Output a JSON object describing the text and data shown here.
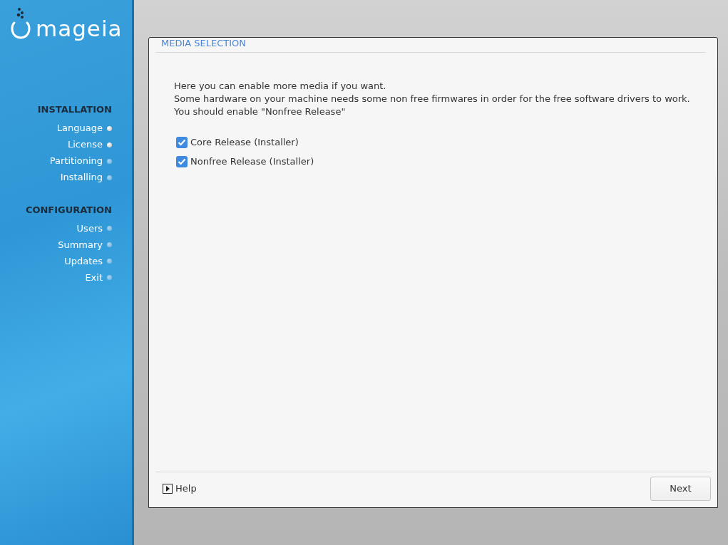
{
  "logo": {
    "text": "mageia"
  },
  "sidebar": {
    "sections": [
      {
        "title": "INSTALLATION",
        "steps": [
          {
            "label": "Language",
            "done": true
          },
          {
            "label": "License",
            "done": true
          },
          {
            "label": "Partitioning",
            "done": false
          },
          {
            "label": "Installing",
            "done": false
          }
        ]
      },
      {
        "title": "CONFIGURATION",
        "steps": [
          {
            "label": "Users",
            "done": false
          },
          {
            "label": "Summary",
            "done": false
          },
          {
            "label": "Updates",
            "done": false
          },
          {
            "label": "Exit",
            "done": false
          }
        ]
      }
    ]
  },
  "dialog": {
    "title": "MEDIA SELECTION",
    "lines": [
      "Here you can enable more media if you want.",
      "Some hardware on your machine needs some non free firmwares in order for the free software drivers to work.",
      "You should enable \"Nonfree Release\""
    ],
    "media": [
      {
        "label": "Core Release (Installer)",
        "checked": true
      },
      {
        "label": "Nonfree Release (Installer)",
        "checked": true
      }
    ],
    "help": "Help",
    "next": "Next"
  }
}
